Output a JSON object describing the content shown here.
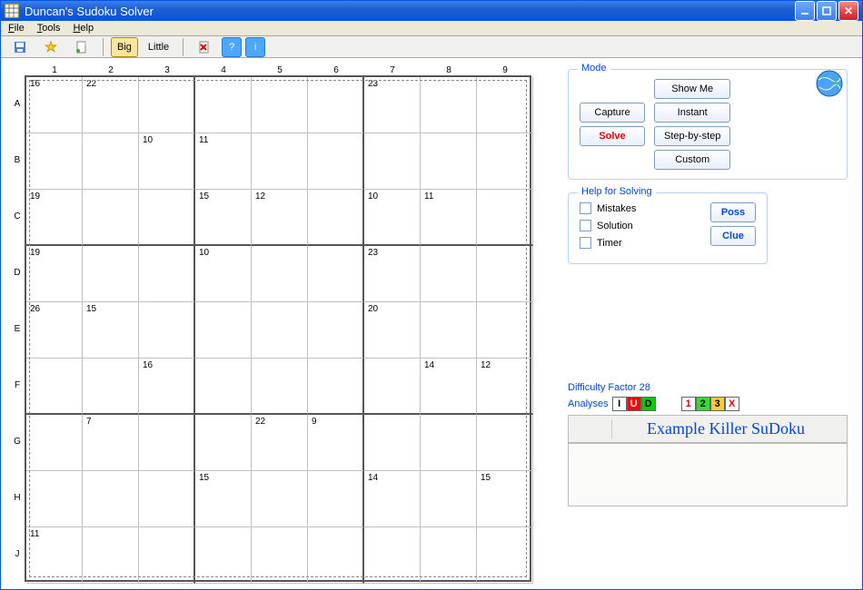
{
  "window": {
    "title": "Duncan's Sudoku Solver"
  },
  "menu": {
    "file": "File",
    "tools": "Tools",
    "help": "Help"
  },
  "toolbar": {
    "big": "Big",
    "little": "Little"
  },
  "grid": {
    "cols": [
      "1",
      "2",
      "3",
      "4",
      "5",
      "6",
      "7",
      "8",
      "9"
    ],
    "rows": [
      "A",
      "B",
      "C",
      "D",
      "E",
      "F",
      "G",
      "H",
      "J"
    ],
    "cage_labels": [
      {
        "r": 0,
        "c": 0,
        "v": "16"
      },
      {
        "r": 0,
        "c": 1,
        "v": "22"
      },
      {
        "r": 0,
        "c": 6,
        "v": "23"
      },
      {
        "r": 1,
        "c": 2,
        "v": "10"
      },
      {
        "r": 1,
        "c": 3,
        "v": "11"
      },
      {
        "r": 2,
        "c": 0,
        "v": "19"
      },
      {
        "r": 2,
        "c": 3,
        "v": "15"
      },
      {
        "r": 2,
        "c": 4,
        "v": "12"
      },
      {
        "r": 2,
        "c": 6,
        "v": "10"
      },
      {
        "r": 2,
        "c": 7,
        "v": "11"
      },
      {
        "r": 3,
        "c": 0,
        "v": "19"
      },
      {
        "r": 3,
        "c": 3,
        "v": "10"
      },
      {
        "r": 3,
        "c": 6,
        "v": "23"
      },
      {
        "r": 4,
        "c": 0,
        "v": "26"
      },
      {
        "r": 4,
        "c": 1,
        "v": "15"
      },
      {
        "r": 4,
        "c": 6,
        "v": "20"
      },
      {
        "r": 5,
        "c": 2,
        "v": "16"
      },
      {
        "r": 5,
        "c": 7,
        "v": "14"
      },
      {
        "r": 5,
        "c": 8,
        "v": "12"
      },
      {
        "r": 6,
        "c": 1,
        "v": "7"
      },
      {
        "r": 6,
        "c": 4,
        "v": "22"
      },
      {
        "r": 6,
        "c": 5,
        "v": "9"
      },
      {
        "r": 7,
        "c": 3,
        "v": "15"
      },
      {
        "r": 7,
        "c": 6,
        "v": "14"
      },
      {
        "r": 7,
        "c": 8,
        "v": "15"
      },
      {
        "r": 8,
        "c": 0,
        "v": "11"
      }
    ]
  },
  "panel": {
    "mode": {
      "legend": "Mode",
      "capture": "Capture",
      "solve": "Solve",
      "showme": "Show Me",
      "instant": "Instant",
      "stepbystep": "Step-by-step",
      "custom": "Custom"
    },
    "help": {
      "legend": "Help for Solving",
      "mistakes": "Mistakes",
      "solution": "Solution",
      "timer": "Timer",
      "poss": "Poss",
      "clue": "Clue"
    }
  },
  "status": {
    "difficulty": "Difficulty Factor 28",
    "analyses_label": "Analyses",
    "title": "Example Killer SuDoku",
    "chips": [
      {
        "t": "I",
        "bg": "#ffffff",
        "fg": "#000"
      },
      {
        "t": "U",
        "bg": "#ff0000",
        "fg": "#fff"
      },
      {
        "t": "D",
        "bg": "#00cc00",
        "fg": "#000"
      },
      {
        "t": "1",
        "bg": "#ffffff",
        "fg": "#d00"
      },
      {
        "t": "2",
        "bg": "#33dd33",
        "fg": "#000"
      },
      {
        "t": "3",
        "bg": "#ffcc33",
        "fg": "#000"
      },
      {
        "t": "X",
        "bg": "#ffffff",
        "fg": "#d00"
      }
    ]
  }
}
